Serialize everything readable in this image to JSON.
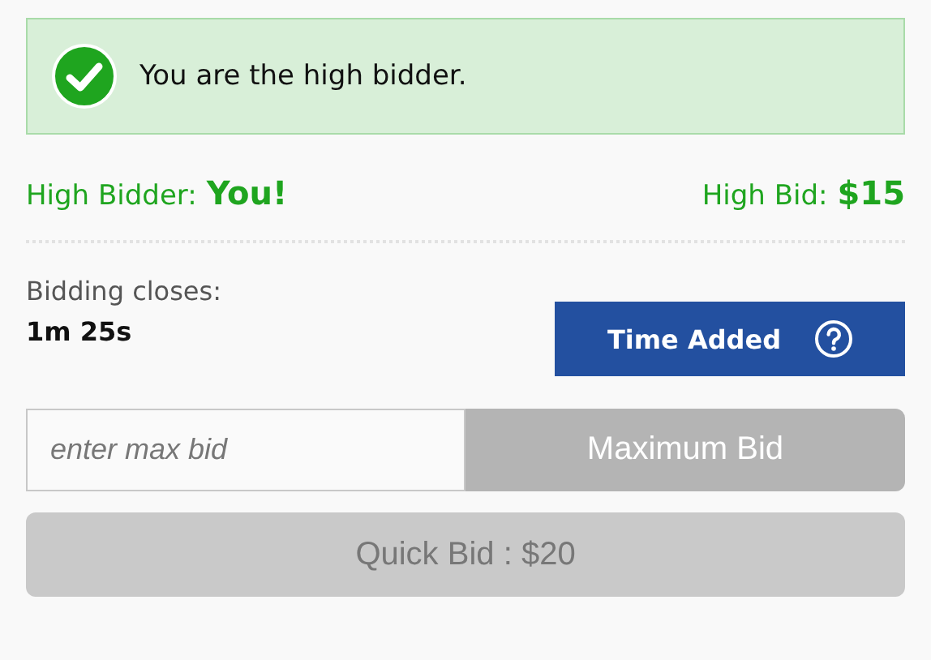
{
  "alert": {
    "message": "You are the high bidder."
  },
  "high_bidder": {
    "label": "High Bidder:",
    "value": "You!"
  },
  "high_bid": {
    "label": "High Bid:",
    "value": "$15"
  },
  "closing": {
    "label": "Bidding closes:",
    "time": "1m 25s"
  },
  "time_added_button": {
    "label": "Time Added"
  },
  "max_bid": {
    "placeholder": "enter max bid",
    "button": {
      "label": "Maximum Bid",
      "disabled": true
    }
  },
  "quick_bid_button": {
    "label": "Quick Bid : $20",
    "disabled": true
  }
}
